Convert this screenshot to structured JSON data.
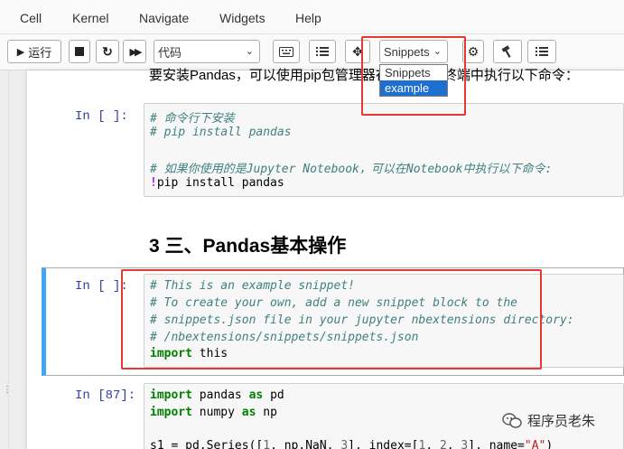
{
  "menubar": {
    "items": [
      "Cell",
      "Kernel",
      "Navigate",
      "Widgets",
      "Help"
    ]
  },
  "toolbar": {
    "run_label": "运行",
    "cell_type": "代码",
    "snippets_select": "Snippets"
  },
  "snippets_dropdown": {
    "options": [
      "Snippets",
      "example"
    ],
    "selected": "example"
  },
  "notebook": {
    "install_note": "要安装Pandas，可以使用pip包管理器在命令行或终端中执行以下命令：",
    "cell1": {
      "prompt": "In [ ]:",
      "lines": [
        "# 命令行下安装",
        "# pip install pandas",
        "",
        "# 如果你使用的是Jupyter Notebook，可以在Notebook中执行以下命令:",
        "!pip install pandas"
      ]
    },
    "heading": "3 三、Pandas基本操作",
    "cell2": {
      "prompt": "In [ ]:",
      "lines": [
        "# This is an example snippet!",
        "# To create your own, add a new snippet block to the",
        "# snippets.json file in your jupyter nbextensions directory:",
        "# /nbextensions/snippets/snippets.json",
        "import this"
      ]
    },
    "cell3": {
      "prompt": "In [87]:",
      "lines": [
        "import pandas as pd",
        "import numpy as np",
        "",
        "s1 = pd.Series([1, np.NaN, 3], index=[1, 2, 3], name=\"A\")"
      ]
    }
  },
  "watermark": "程序员老朱",
  "colors": {
    "highlight_border": "#e53935",
    "selected_cell_bar": "#42a5f5",
    "dropdown_active": "#1e6fd0",
    "prompt": "#303f9f"
  }
}
